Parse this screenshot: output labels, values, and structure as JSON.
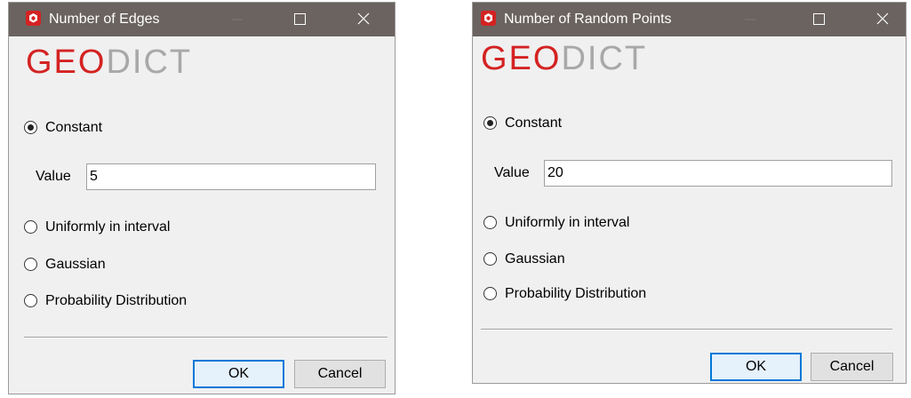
{
  "colors": {
    "titlebar": "#6a635f",
    "logo_geo": "#d42222",
    "logo_dict": "#a8a8a8",
    "dialog_bg": "#f0f0f0",
    "default_button_border": "#0078d7"
  },
  "dialogs": [
    {
      "title": "Number of Edges",
      "icon": "geodict-app-icon",
      "logo": {
        "geo": "GEO",
        "dict": "DICT"
      },
      "options": [
        {
          "label": "Constant",
          "checked": true
        },
        {
          "label": "Uniformly in interval",
          "checked": false
        },
        {
          "label": "Gaussian",
          "checked": false
        },
        {
          "label": "Probability Distribution",
          "checked": false
        }
      ],
      "value_label": "Value",
      "value": "5",
      "ok_label": "OK",
      "cancel_label": "Cancel"
    },
    {
      "title": "Number of Random Points",
      "icon": "geodict-app-icon",
      "logo": {
        "geo": "GEO",
        "dict": "DICT"
      },
      "options": [
        {
          "label": "Constant",
          "checked": true
        },
        {
          "label": "Uniformly in interval",
          "checked": false
        },
        {
          "label": "Gaussian",
          "checked": false
        },
        {
          "label": "Probability Distribution",
          "checked": false
        }
      ],
      "value_label": "Value",
      "value": "20",
      "ok_label": "OK",
      "cancel_label": "Cancel"
    }
  ]
}
